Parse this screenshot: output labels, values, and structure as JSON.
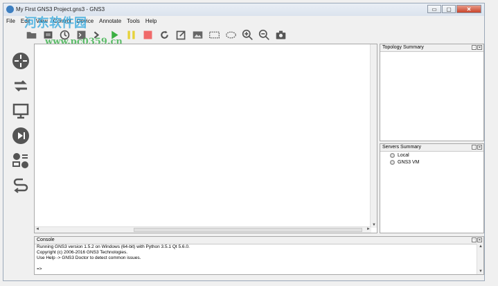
{
  "window": {
    "title": "My First GNS3 Project.gns3 - GNS3",
    "minimize": "▭",
    "maximize": "▢",
    "close": "✕"
  },
  "menu": [
    "File",
    "Edit",
    "View",
    "Control",
    "Device",
    "Annotate",
    "Tools",
    "Help"
  ],
  "watermark": {
    "text": "河东软件园",
    "url": "www.pc0359.cn"
  },
  "toolbar": [
    "folder-open-icon",
    "snapshot-icon",
    "clock-icon",
    "console-all-icon",
    "terminal-icon",
    "start-icon",
    "suspend-icon",
    "stop-icon",
    "reload-icon",
    "add-note-icon",
    "insert-image-icon",
    "draw-rectangle-icon",
    "draw-ellipse-icon",
    "zoom-in-icon",
    "zoom-out-icon",
    "screenshot-icon"
  ],
  "sidebar": [
    "routers-icon",
    "switches-icon",
    "end-devices-icon",
    "security-devices-icon",
    "all-devices-icon",
    "add-link-icon"
  ],
  "topology": {
    "title": "Topology Summary"
  },
  "servers": {
    "title": "Servers Summary",
    "items": [
      {
        "name": "Local"
      },
      {
        "name": "GNS3 VM"
      }
    ]
  },
  "console": {
    "title": "Console",
    "lines": [
      "Running GNS3 version 1.5.2 on Windows (64-bit) with Python 3.5.1 Qt 5.6.0.",
      "Copyright (c) 2006-2016 GNS3 Technologies.",
      "Use Help -> GNS3 Doctor to detect common issues.",
      "",
      "=>"
    ]
  },
  "colors": {
    "accent": "#3d7fc1",
    "icon": "#555555",
    "start": "#3cb043",
    "suspend": "#e6d23a",
    "stop": "#f06a6a"
  }
}
